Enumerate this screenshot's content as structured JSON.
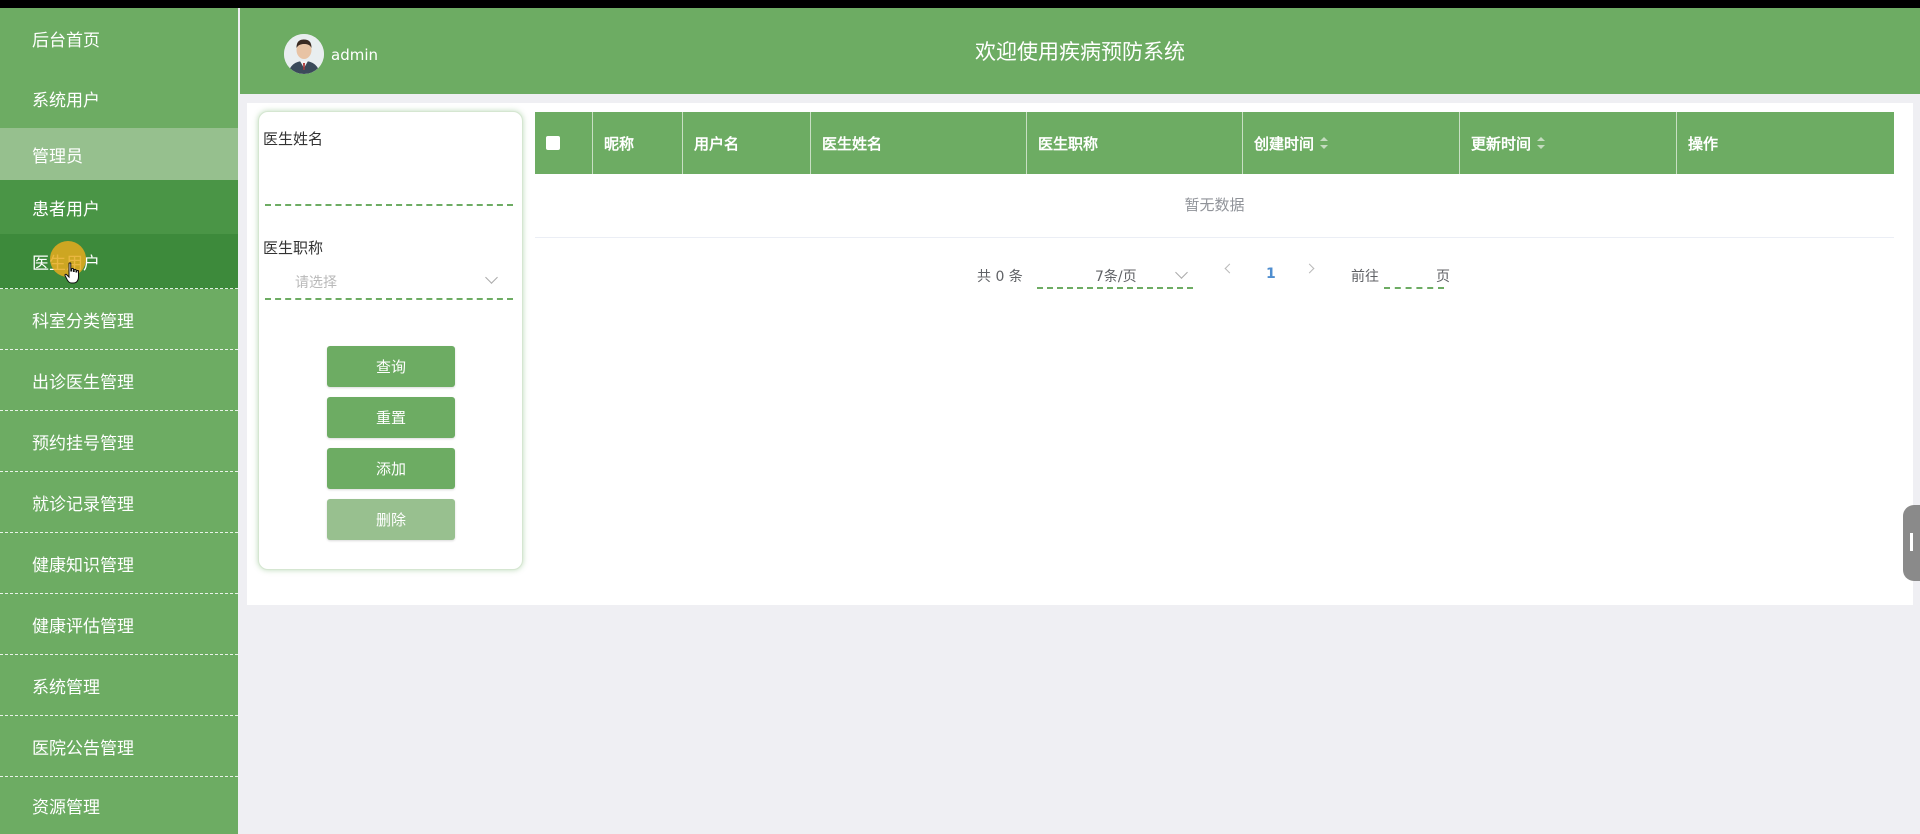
{
  "sidebar": {
    "items": [
      {
        "label": "后台首页"
      },
      {
        "label": "系统用户"
      },
      {
        "label": "管理员"
      },
      {
        "label": "患者用户"
      },
      {
        "label": "医生用户"
      },
      {
        "label": "科室分类管理"
      },
      {
        "label": "出诊医生管理"
      },
      {
        "label": "预约挂号管理"
      },
      {
        "label": "就诊记录管理"
      },
      {
        "label": "健康知识管理"
      },
      {
        "label": "健康评估管理"
      },
      {
        "label": "系统管理"
      },
      {
        "label": "医院公告管理"
      },
      {
        "label": "资源管理"
      }
    ]
  },
  "header": {
    "username": "admin",
    "title": "欢迎使用疾病预防系统"
  },
  "search": {
    "name_label": "医生姓名",
    "name_value": "",
    "title_label": "医生职称",
    "title_placeholder": "请选择",
    "query_button": "查询",
    "reset_button": "重置",
    "add_button": "添加",
    "delete_button": "删除"
  },
  "table": {
    "columns": [
      "昵称",
      "用户名",
      "医生姓名",
      "医生职称",
      "创建时间",
      "更新时间",
      "操作"
    ],
    "empty_text": "暂无数据"
  },
  "pagination": {
    "total": "共 0 条",
    "page_size": "7条/页",
    "current_page": "1",
    "goto_label": "前往",
    "page_suffix": "页"
  },
  "colors": {
    "primary": "#6dac63",
    "background": "#efeff3"
  }
}
